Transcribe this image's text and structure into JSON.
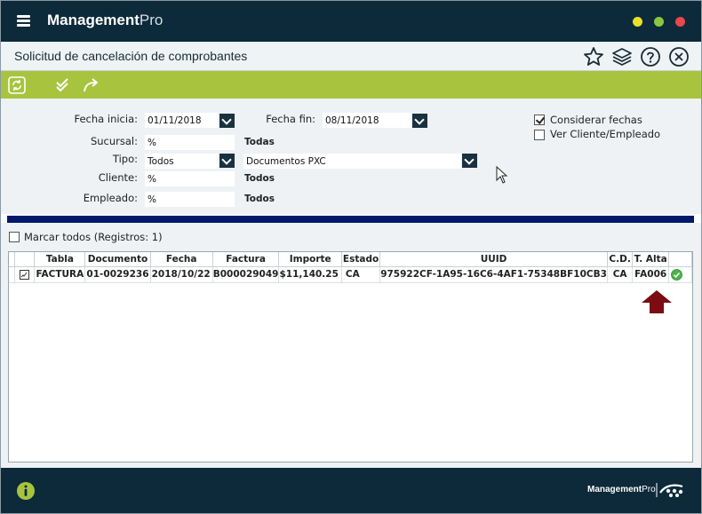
{
  "app": {
    "brand_bold": "Management",
    "brand_light": "Pro"
  },
  "window_controls": {
    "minimize_color": "#e8e02a",
    "maximize_color": "#8cc63f",
    "close_color": "#e8474c"
  },
  "header": {
    "title": "Solicitud de cancelación de comprobantes"
  },
  "form": {
    "fecha_inicia_label": "Fecha inicia:",
    "fecha_inicia_value": "01/11/2018",
    "fecha_fin_label": "Fecha fin:",
    "fecha_fin_value": "08/11/2018",
    "sucursal_label": "Sucursal:",
    "sucursal_value": "%",
    "sucursal_desc": "Todas",
    "tipo_label": "Tipo:",
    "tipo_value": "Todos",
    "tipo_desc": "Documentos PXC",
    "cliente_label": "Cliente:",
    "cliente_value": "%",
    "cliente_desc": "Todos",
    "empleado_label": "Empleado:",
    "empleado_value": "%",
    "empleado_desc": "Todos",
    "considerar_fechas_label": "Considerar fechas",
    "considerar_fechas_checked": true,
    "ver_cliente_label": "Ver Cliente/Empleado",
    "ver_cliente_checked": false
  },
  "grid": {
    "select_all_label": "Marcar todos (Registros: 1)",
    "columns": [
      "",
      "Tabla",
      "Documento",
      "Fecha",
      "Factura",
      "Importe",
      "Estado",
      "UUID",
      "C.D.",
      "T. Alta",
      ""
    ],
    "rows": [
      {
        "tabla": "FACTURA",
        "documento": "01-0029236",
        "fecha": "2018/10/22",
        "factura": "B000029049",
        "importe": "$11,140.25",
        "estado": "CA",
        "uuid": "975922CF-1A95-16C6-4AF1-75348BF10CB3",
        "cd": "CA",
        "t_alta": "FA006"
      }
    ]
  },
  "annotation": {
    "arrow_color": "#7a0c12"
  },
  "footer": {
    "brand_bold": "Management",
    "brand_light": "Pro"
  }
}
